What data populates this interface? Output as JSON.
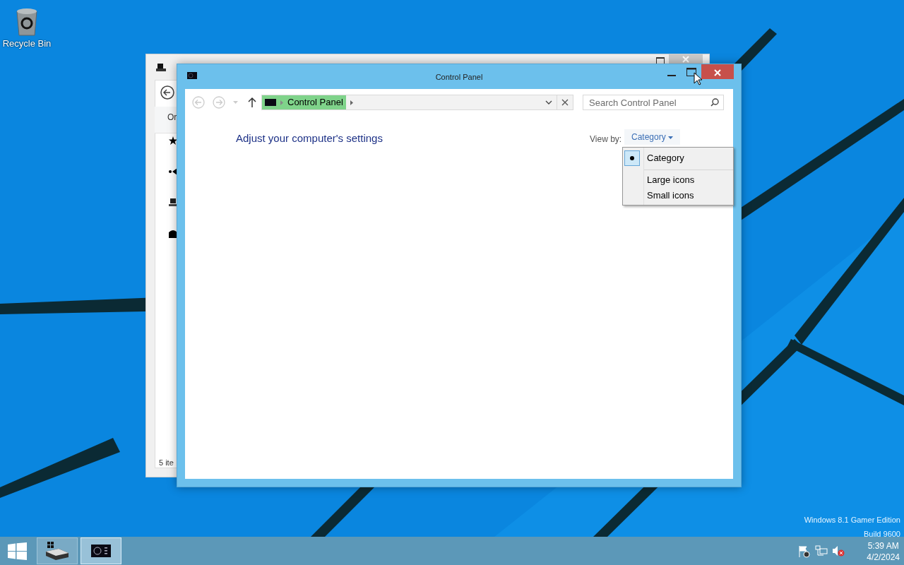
{
  "desktop": {
    "icons": [
      {
        "label": "Recycle Bin"
      }
    ],
    "watermark": [
      "Windows 8.1 Gamer Edition",
      "Build 9600"
    ]
  },
  "background_window": {
    "toolbar_text": "Or",
    "status": "5 ite"
  },
  "window": {
    "title": "Control Panel",
    "breadcrumb": [
      "Control Panel"
    ],
    "search": {
      "placeholder": "Search Control Panel"
    },
    "heading": "Adjust your computer's settings",
    "view_by": {
      "label": "View by:",
      "value": "Category"
    },
    "menu": [
      {
        "label": "Category",
        "selected": true
      },
      {
        "label": "Large icons",
        "selected": false
      },
      {
        "label": "Small icons",
        "selected": false
      }
    ]
  },
  "taskbar": {
    "apps": [
      {
        "kind": "explorer",
        "selected": false
      },
      {
        "kind": "control",
        "selected": true
      }
    ],
    "time": "5:39 AM",
    "date": "4/2/2024"
  }
}
